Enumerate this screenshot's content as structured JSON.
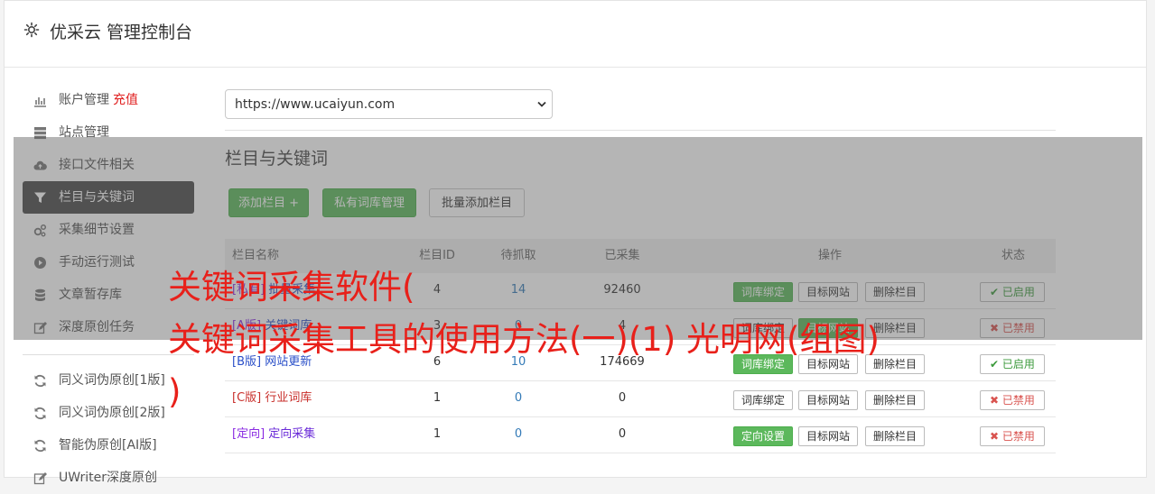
{
  "header": {
    "title": "优采云 管理控制台"
  },
  "sidebar": {
    "items": [
      {
        "label": "账户管理",
        "extra": "充值",
        "icon": "bar-chart-icon"
      },
      {
        "label": "站点管理",
        "icon": "server-icon"
      },
      {
        "label": "接口文件相关",
        "icon": "cloud-upload-icon"
      },
      {
        "label": "栏目与关键词",
        "icon": "filter-icon",
        "active": true
      },
      {
        "label": "采集细节设置",
        "icon": "cogs-icon"
      },
      {
        "label": "手动运行测试",
        "icon": "play-circle-icon"
      },
      {
        "label": "文章暂存库",
        "icon": "database-icon"
      },
      {
        "label": "深度原创任务",
        "icon": "edit-icon"
      }
    ],
    "items2": [
      {
        "label": "同义词伪原创[1版]",
        "icon": "refresh-icon"
      },
      {
        "label": "同义词伪原创[2版]",
        "icon": "refresh-icon"
      },
      {
        "label": "智能伪原创[AI版]",
        "icon": "refresh-icon"
      },
      {
        "label": "UWriter深度原创",
        "icon": "edit-icon"
      }
    ]
  },
  "site_select": {
    "value": "https://www.ucaiyun.com"
  },
  "section": {
    "title": "栏目与关键词"
  },
  "buttons": {
    "add_column": "添加栏目 +",
    "private_lib": "私有词库管理",
    "batch_add": "批量添加栏目"
  },
  "table": {
    "headers": {
      "name": "栏目名称",
      "id": "栏目ID",
      "wait": "待抓取",
      "done": "已采集",
      "op": "操作",
      "state": "状态"
    },
    "rows": [
      {
        "tag": "[私有]",
        "name": "批量采集...",
        "id": "4",
        "wait": "14",
        "done": "92460",
        "op1": "词库绑定",
        "op2": "目标网站",
        "op3": "删除栏目",
        "state": "已启用"
      },
      {
        "tag": "[A版]",
        "name": "关键词库",
        "id": "3",
        "wait": "0",
        "done": "4",
        "op1": "词库绑定",
        "op2": "目标网站",
        "op3": "删除栏目",
        "state": "已禁用"
      },
      {
        "tag": "[B版]",
        "name": "网站更新",
        "id": "6",
        "wait": "10",
        "done": "174669",
        "op1": "词库绑定",
        "op2": "目标网站",
        "op3": "删除栏目",
        "state": "已启用"
      },
      {
        "tag": "[C版]",
        "name": "行业词库",
        "id": "1",
        "wait": "0",
        "done": "0",
        "op1": "词库绑定",
        "op2": "目标网站",
        "op3": "删除栏目",
        "state": "已禁用"
      },
      {
        "tag": "[定向]",
        "name": "定向采集",
        "id": "1",
        "wait": "0",
        "done": "0",
        "op1": "定向设置",
        "op2": "目标网站",
        "op3": "删除栏目",
        "state": "已禁用"
      }
    ]
  },
  "overlay_text": {
    "line1": "关键词采集软件(",
    "line2": "关键词采集工具的使用方法(一)(1) 光明网(组图)",
    "line3": ")"
  }
}
